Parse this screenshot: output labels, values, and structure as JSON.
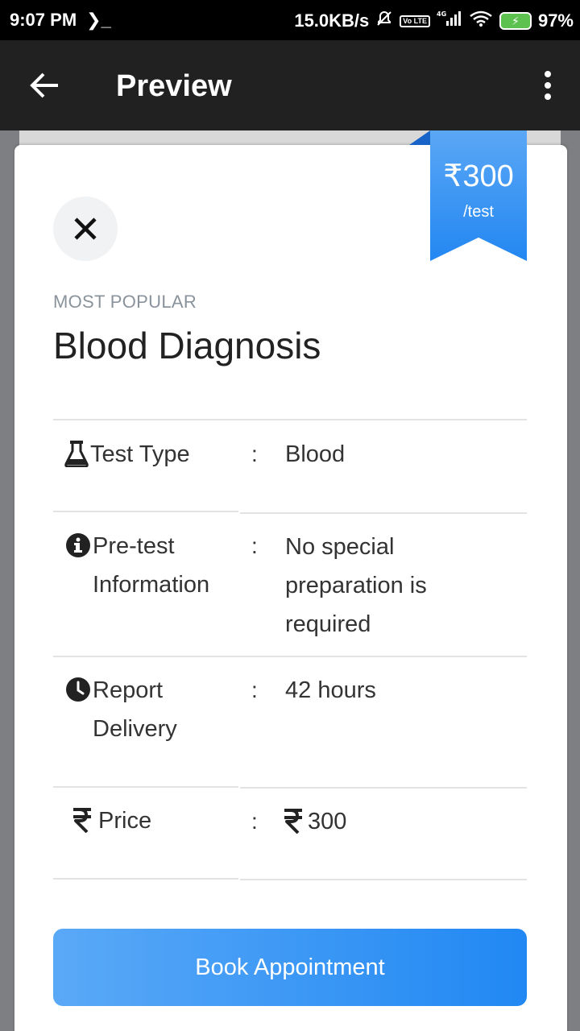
{
  "status_bar": {
    "time": "9:07 PM",
    "terminal_glyph": "❯_",
    "net_speed": "15.0KB/s",
    "lte": "Vo LTE",
    "network": "4G",
    "battery": "97%"
  },
  "app_bar": {
    "title": "Preview"
  },
  "ribbon": {
    "amount": "₹300",
    "per": "/test"
  },
  "card": {
    "kicker": "MOST POPULAR",
    "title": "Blood Diagnosis",
    "rows": [
      {
        "label": "Test Type",
        "colon": ":",
        "value": "Blood",
        "icon": "flask-icon"
      },
      {
        "label_line1": "Pre-test",
        "label_line2": "Information",
        "colon": ":",
        "value_line1": "No special",
        "value_line2": "preparation is",
        "value_line3": "required",
        "icon": "info-icon"
      },
      {
        "label_line1": "Report",
        "label_line2": "Delivery",
        "colon": ":",
        "value": "42 hours",
        "icon": "clock-icon"
      },
      {
        "label": "Price",
        "colon": ":",
        "value": "300",
        "icon": "rupee-icon"
      }
    ],
    "book_button": "Book Appointment"
  },
  "colors": {
    "accent_blue": "#2387f2",
    "appbar": "#212121"
  }
}
